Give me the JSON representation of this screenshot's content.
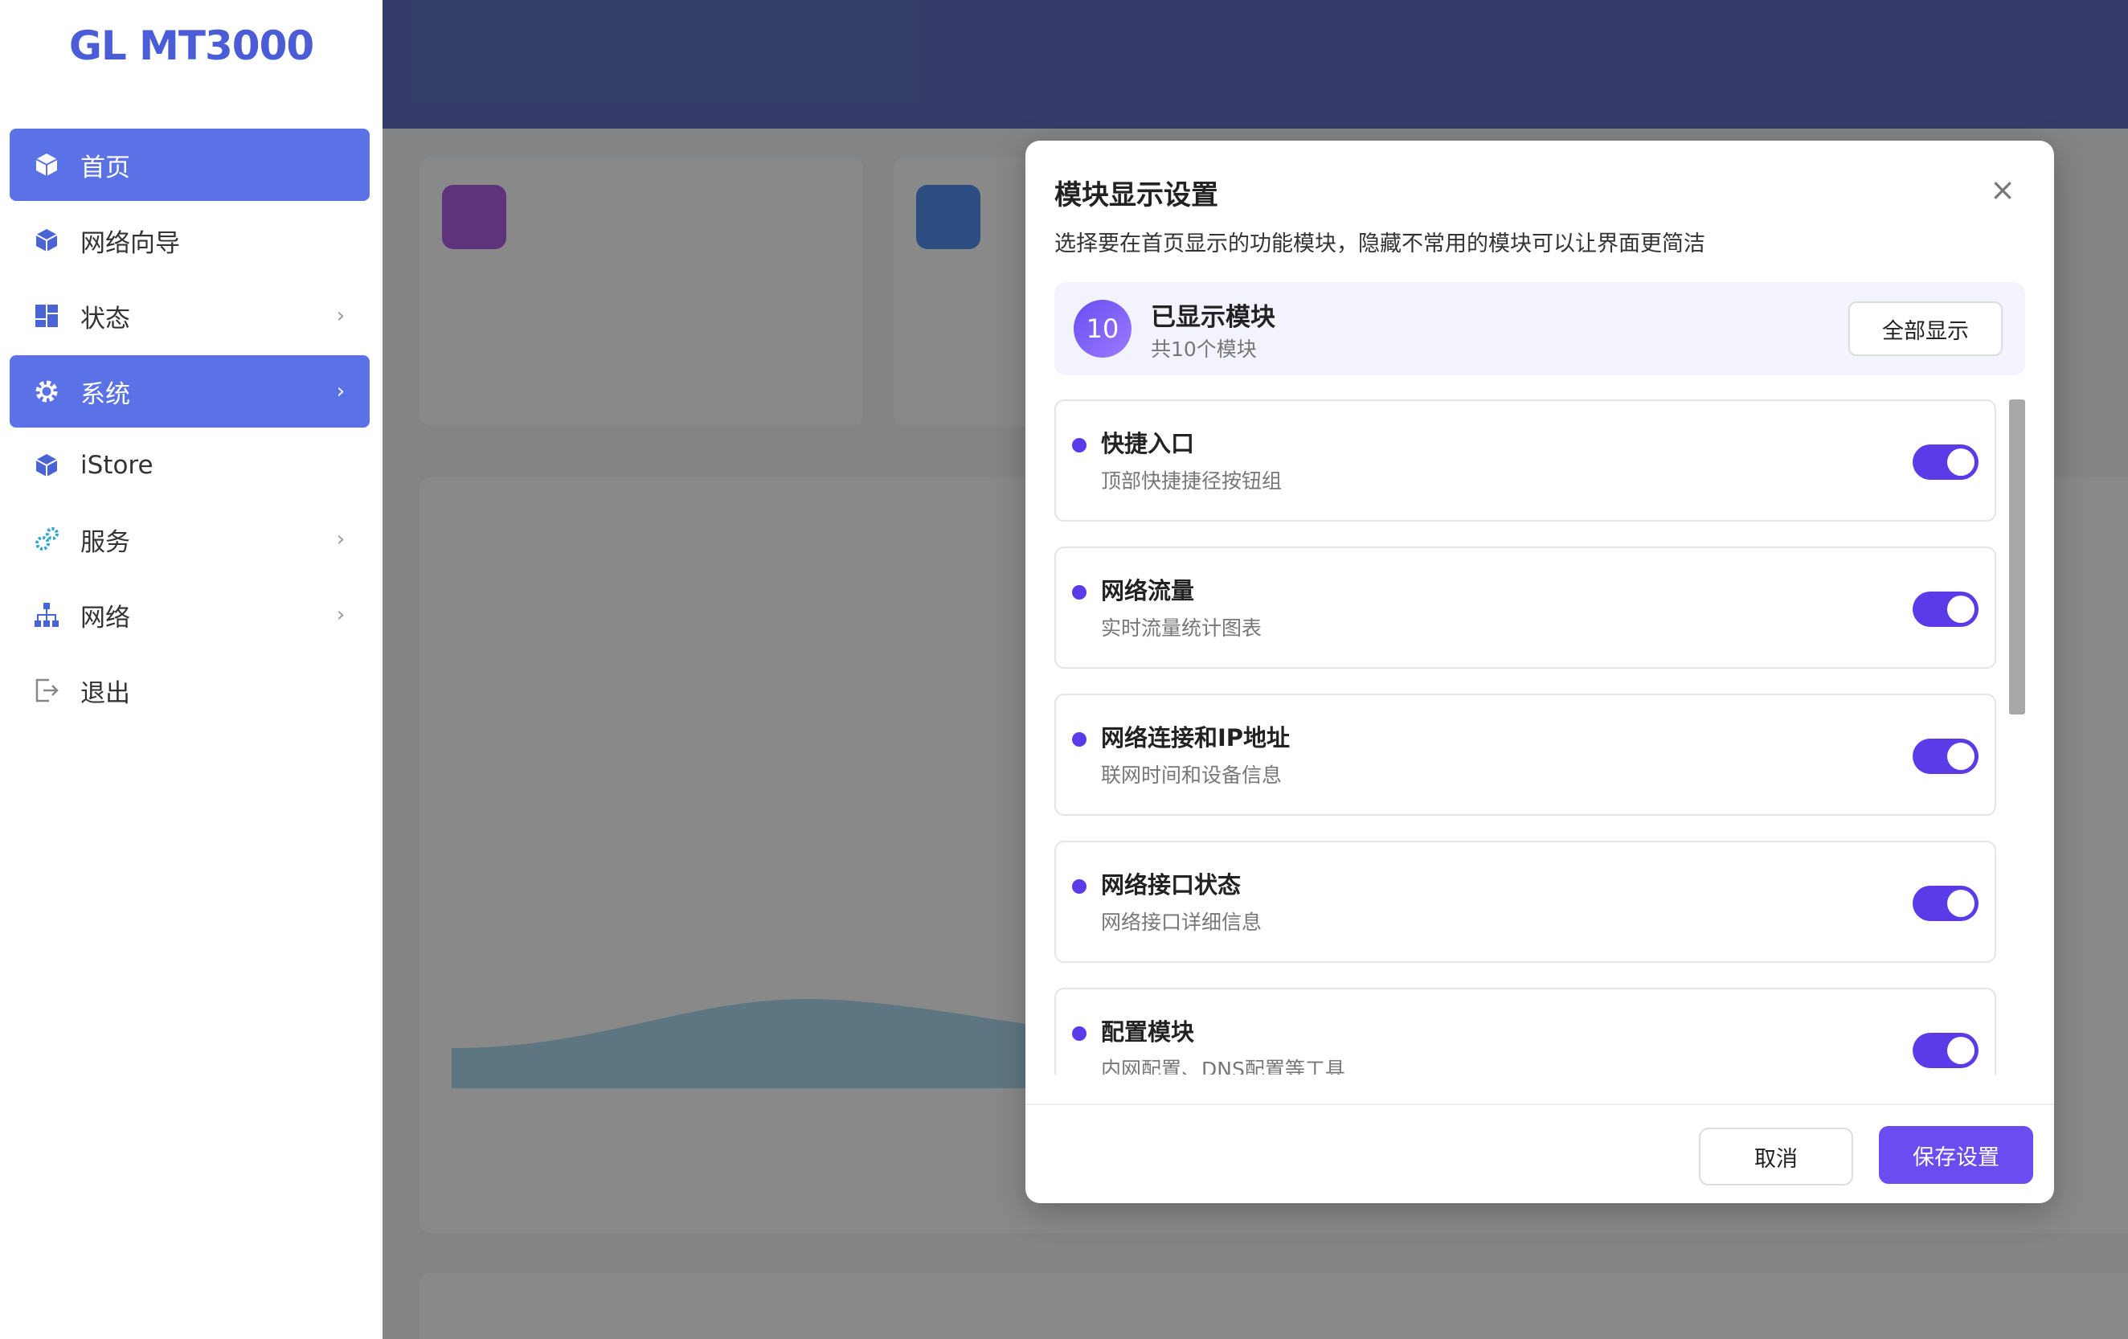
{
  "brand": "GL MT3000",
  "sidebar": {
    "items": [
      {
        "label": "首页",
        "icon": "cube-icon",
        "active": true,
        "chevron": false
      },
      {
        "label": "网络向导",
        "icon": "cube-icon",
        "active": false,
        "chevron": false
      },
      {
        "label": "状态",
        "icon": "dashboard-icon",
        "active": false,
        "chevron": true
      },
      {
        "label": "系统",
        "icon": "gear-icon",
        "active": true,
        "chevron": true
      },
      {
        "label": "iStore",
        "icon": "cube-icon",
        "active": false,
        "chevron": false
      },
      {
        "label": "服务",
        "icon": "gears-icon",
        "active": false,
        "chevron": true
      },
      {
        "label": "网络",
        "icon": "sitemap-icon",
        "active": false,
        "chevron": true
      },
      {
        "label": "退出",
        "icon": "logout-icon",
        "active": false,
        "chevron": false
      }
    ]
  },
  "modal": {
    "title": "模块显示设置",
    "close_symbol": "×",
    "description": "选择要在首页显示的功能模块，隐藏不常用的模块可以让界面更简洁",
    "summary": {
      "count": "10",
      "title": "已显示模块",
      "subtitle": "共10个模块",
      "show_all_label": "全部显示"
    },
    "modules": [
      {
        "title": "快捷入口",
        "description": "顶部快捷捷径按钮组",
        "enabled": true
      },
      {
        "title": "网络流量",
        "description": "实时流量统计图表",
        "enabled": true
      },
      {
        "title": "网络连接和IP地址",
        "description": "联网时间和设备信息",
        "enabled": true
      },
      {
        "title": "网络接口状态",
        "description": "网络接口详细信息",
        "enabled": true
      },
      {
        "title": "配置模块",
        "description": "内网配置、DNS配置等工具",
        "enabled": true
      }
    ],
    "cancel_label": "取消",
    "save_label": "保存设置"
  },
  "colors": {
    "accent": "#6a4cf0",
    "sidebar_active": "#5b72e6",
    "topbar": "#4556b8",
    "brand": "#4a5dd6"
  }
}
